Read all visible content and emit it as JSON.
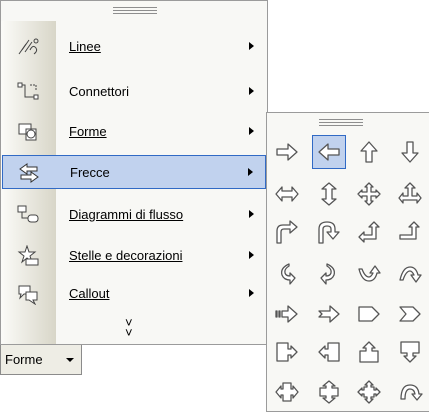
{
  "menu": {
    "items": [
      {
        "label": "Linee",
        "icon": "lines-icon",
        "submenu": true
      },
      {
        "label": "Connettori",
        "icon": "connectors-icon",
        "submenu": true
      },
      {
        "label": "Forme",
        "icon": "basic-shapes-icon",
        "submenu": true
      },
      {
        "label": "Frecce",
        "icon": "block-arrows-icon",
        "submenu": true,
        "selected": true
      },
      {
        "label": "Diagrammi di flusso",
        "icon": "flowchart-icon",
        "submenu": true
      },
      {
        "label": "Stelle e decorazioni",
        "icon": "stars-banners-icon",
        "submenu": true
      },
      {
        "label": "Callout",
        "icon": "callout-icon",
        "submenu": true
      }
    ],
    "expand_glyph": "»"
  },
  "toolbar": {
    "button_label": "Forme"
  },
  "palette": {
    "grid": [
      [
        "right-arrow-icon",
        "left-arrow-icon",
        "up-arrow-icon",
        "down-arrow-icon"
      ],
      [
        "left-right-arrow-icon",
        "up-down-arrow-icon",
        "quad-arrow-icon",
        "left-right-up-arrow-icon"
      ],
      [
        "bent-arrow-icon",
        "u-turn-arrow-icon",
        "left-up-arrow-icon",
        "bent-up-arrow-icon"
      ],
      [
        "curved-right-arrow-icon",
        "curved-left-arrow-icon",
        "curved-up-arrow-icon",
        "curved-down-arrow-icon"
      ],
      [
        "striped-right-arrow-icon",
        "notched-right-arrow-icon",
        "pentagon-icon",
        "chevron-icon"
      ],
      [
        "right-arrow-callout-icon",
        "left-arrow-callout-icon",
        "up-arrow-callout-icon",
        "down-arrow-callout-icon"
      ],
      [
        "left-right-arrow-callout-icon",
        "up-down-arrow-callout-icon",
        "quad-arrow-callout-icon",
        "circular-arrow-icon"
      ]
    ],
    "selected": "left-arrow-icon"
  },
  "colors": {
    "selection_fill": "#c1d2ee",
    "selection_border": "#316ac5",
    "menu_bg": "#f8f8f5"
  }
}
